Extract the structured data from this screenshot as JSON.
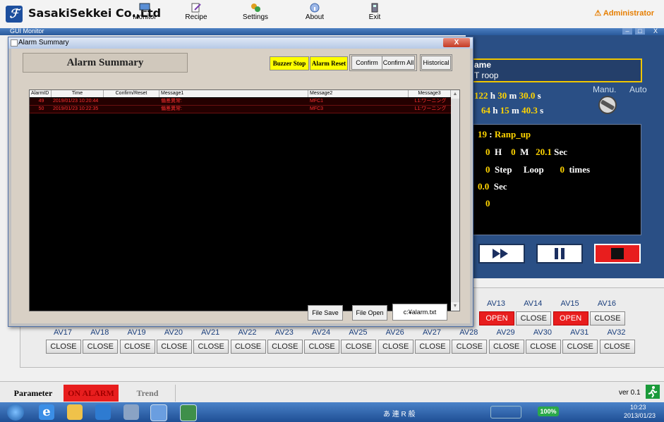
{
  "header": {
    "logo_glyph": "ℱ",
    "company": "SasakiSekkei Co.,Ltd",
    "nav": [
      {
        "label": "Monitor",
        "icon": "monitor-icon"
      },
      {
        "label": "Recipe",
        "icon": "recipe-icon"
      },
      {
        "label": "Settings",
        "icon": "settings-icon"
      },
      {
        "label": "About",
        "icon": "about-icon"
      },
      {
        "label": "Exit",
        "icon": "exit-icon"
      }
    ],
    "user": "Administrator",
    "warning_glyph": "⚠"
  },
  "gui_window": {
    "title": "GUI Monitor",
    "min": "–",
    "max": "□",
    "close": "X"
  },
  "alarm_window": {
    "title": "Alarm Summary",
    "heading": "Alarm Summary",
    "close": "X",
    "buttons": {
      "buzzer_stop": "Buzzer Stop",
      "alarm_reset": "Alarm Reset",
      "confirm": "Confirm",
      "confirm_all": "Confirm All",
      "historical": "Historical"
    },
    "columns": [
      "AlarmID",
      "Time",
      "Confirm/Reset",
      "Message1",
      "Message2",
      "Message3"
    ],
    "rows": [
      {
        "id": "49",
        "time": "2019/01/23 10:20:44",
        "confirm": "",
        "msg1": "偏差異常:",
        "msg2": "MFC1",
        "msg3": "L1:ワーニング"
      },
      {
        "id": "50",
        "time": "2019/01/23 10:22:35",
        "confirm": "",
        "msg1": "偏差異常:",
        "msg2": "MFC3",
        "msg3": "L1:ワーニング"
      }
    ],
    "scroll_up": "▲",
    "scroll_down": "▼",
    "file_save": "File Save",
    "file_open": "File Open",
    "file_path": "c:¥alarm.txt"
  },
  "right_panel": {
    "name_label": "ame",
    "name_value": "T roop",
    "time1": {
      "h": "122",
      "m": "30",
      "s": "30.0"
    },
    "time2": {
      "h": "64",
      "m": "15",
      "s": "40.3"
    },
    "mode_manu": "Manu.",
    "mode_auto": "Auto",
    "step_no": "19",
    "step_name": "Ranp_up",
    "remain": {
      "h": "0",
      "m": "0",
      "s": "20.1"
    },
    "unit_h": "H",
    "unit_m": "M",
    "unit_sec": "Sec",
    "step_loop_value": "0",
    "step_label": "Step",
    "loop_label": "Loop",
    "loop_value": "0",
    "times_label": "times",
    "sec_value": "0.0",
    "sec_label": "Sec",
    "last_value": "0",
    "h_letter": "h",
    "m_letter": "m",
    "s_letter": "s",
    "colon": ":"
  },
  "av_top": [
    {
      "label": "AV13",
      "state": "OPEN"
    },
    {
      "label": "AV14",
      "state": "CLOSE"
    },
    {
      "label": "AV15",
      "state": "OPEN"
    },
    {
      "label": "AV16",
      "state": "CLOSE"
    }
  ],
  "av_bottom": [
    {
      "label": "AV17",
      "state": "CLOSE"
    },
    {
      "label": "AV18",
      "state": "CLOSE"
    },
    {
      "label": "AV19",
      "state": "CLOSE"
    },
    {
      "label": "AV20",
      "state": "CLOSE"
    },
    {
      "label": "AV21",
      "state": "CLOSE"
    },
    {
      "label": "AV22",
      "state": "CLOSE"
    },
    {
      "label": "AV23",
      "state": "CLOSE"
    },
    {
      "label": "AV24",
      "state": "CLOSE"
    },
    {
      "label": "AV25",
      "state": "CLOSE"
    },
    {
      "label": "AV26",
      "state": "CLOSE"
    },
    {
      "label": "AV27",
      "state": "CLOSE"
    },
    {
      "label": "AV28",
      "state": "CLOSE"
    },
    {
      "label": "AV29",
      "state": "CLOSE"
    },
    {
      "label": "AV30",
      "state": "CLOSE"
    },
    {
      "label": "AV31",
      "state": "CLOSE"
    },
    {
      "label": "AV32",
      "state": "CLOSE"
    }
  ],
  "tabs": {
    "parameter": "Parameter",
    "on_alarm": "ON ALARM",
    "trend": "Trend",
    "version": "ver 0.1"
  },
  "taskbar": {
    "zoom": "100%",
    "time": "10:23",
    "date": "2013/01/23",
    "ime": "あ 連 R 般"
  },
  "colors": {
    "alarm_red": "#ff3030",
    "open_red": "#e81e1e",
    "buzzer_yellow": "#ffff00",
    "panel_blue": "#2a4f85",
    "accent_yellow": "#ffd400"
  }
}
